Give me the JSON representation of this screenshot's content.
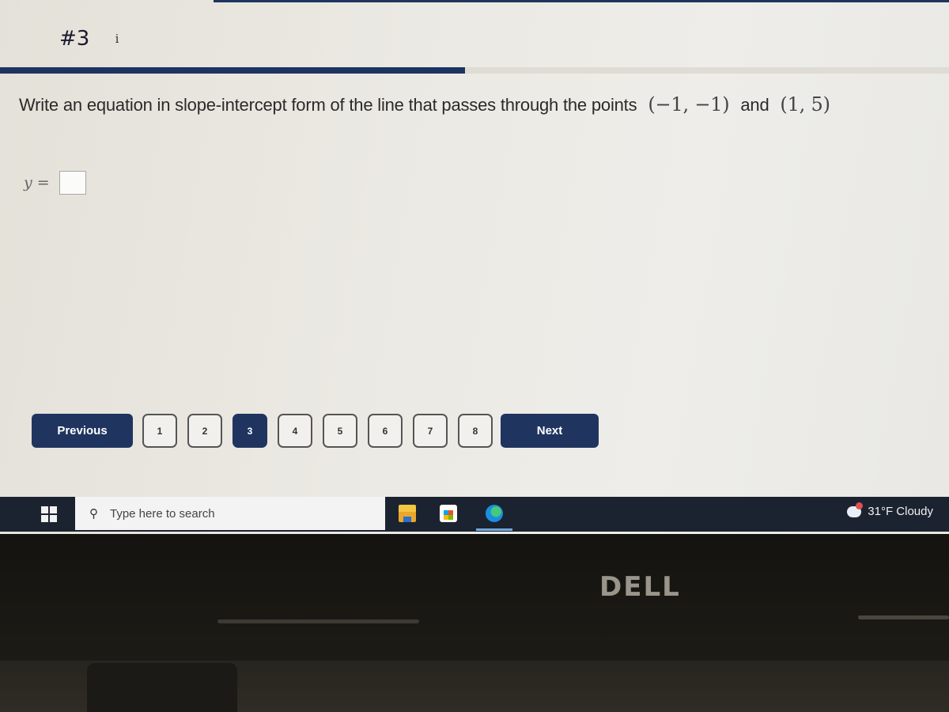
{
  "question": {
    "number": "#3",
    "info_icon": "info-icon",
    "progress_fraction": 0.49,
    "prompt": "Write an equation in slope-intercept form of the line that passes through the points",
    "point1": "(−1, −1)",
    "conjunction": "and",
    "point2": "(1, 5)",
    "answer_label": "y =",
    "answer_value": ""
  },
  "navigation": {
    "previous_label": "Previous",
    "next_label": "Next",
    "pages": [
      "1",
      "2",
      "3",
      "4",
      "5",
      "6",
      "7",
      "8"
    ],
    "current_page": "3"
  },
  "taskbar": {
    "start_icon": "windows-start-icon",
    "search_placeholder": "Type here to search",
    "pinned_apps": [
      "file-explorer-icon",
      "microsoft-store-icon",
      "edge-icon"
    ],
    "weather": "31°F  Cloudy"
  },
  "device": {
    "brand_logo": "DELL"
  },
  "colors": {
    "accent": "#1f3560",
    "taskbar": "#1c2330"
  }
}
